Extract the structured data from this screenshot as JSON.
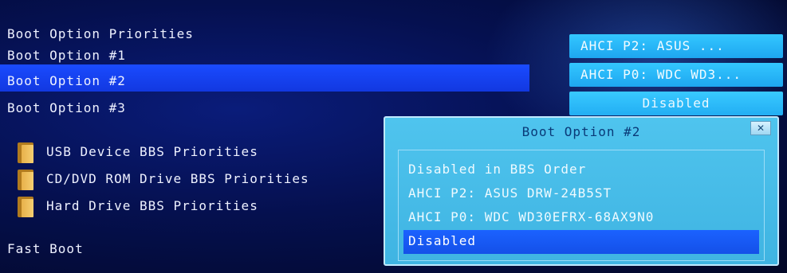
{
  "left_panel": {
    "section_title": "Boot Option Priorities",
    "boot_options": [
      "Boot Option #1",
      "Boot Option #2",
      "Boot Option #3"
    ],
    "submenus": [
      "USB Device BBS Priorities",
      "CD/DVD ROM Drive BBS Priorities",
      "Hard Drive BBS Priorities"
    ],
    "fast_boot": "Fast Boot"
  },
  "right_panel": {
    "values": [
      "AHCI P2: ASUS    ...",
      "AHCI P0: WDC WD3...",
      "Disabled"
    ]
  },
  "popup": {
    "title": "Boot Option #2",
    "close_symbol": "✕",
    "options": [
      "Disabled in BBS Order",
      "AHCI P2: ASUS    DRW-24B5ST",
      "AHCI P0: WDC WD30EFRX-68AX9N0",
      "Disabled"
    ],
    "selected_index": 3
  },
  "colors": {
    "background": "#05104f",
    "row_highlight": "#1a4bff",
    "value_button": "#33c7ff",
    "popup_bg": "#4fc4ee",
    "popup_selected": "#1b62ff"
  },
  "icons": {
    "submenu_icon": "folder-icon",
    "popup_close_icon": "close-icon"
  }
}
